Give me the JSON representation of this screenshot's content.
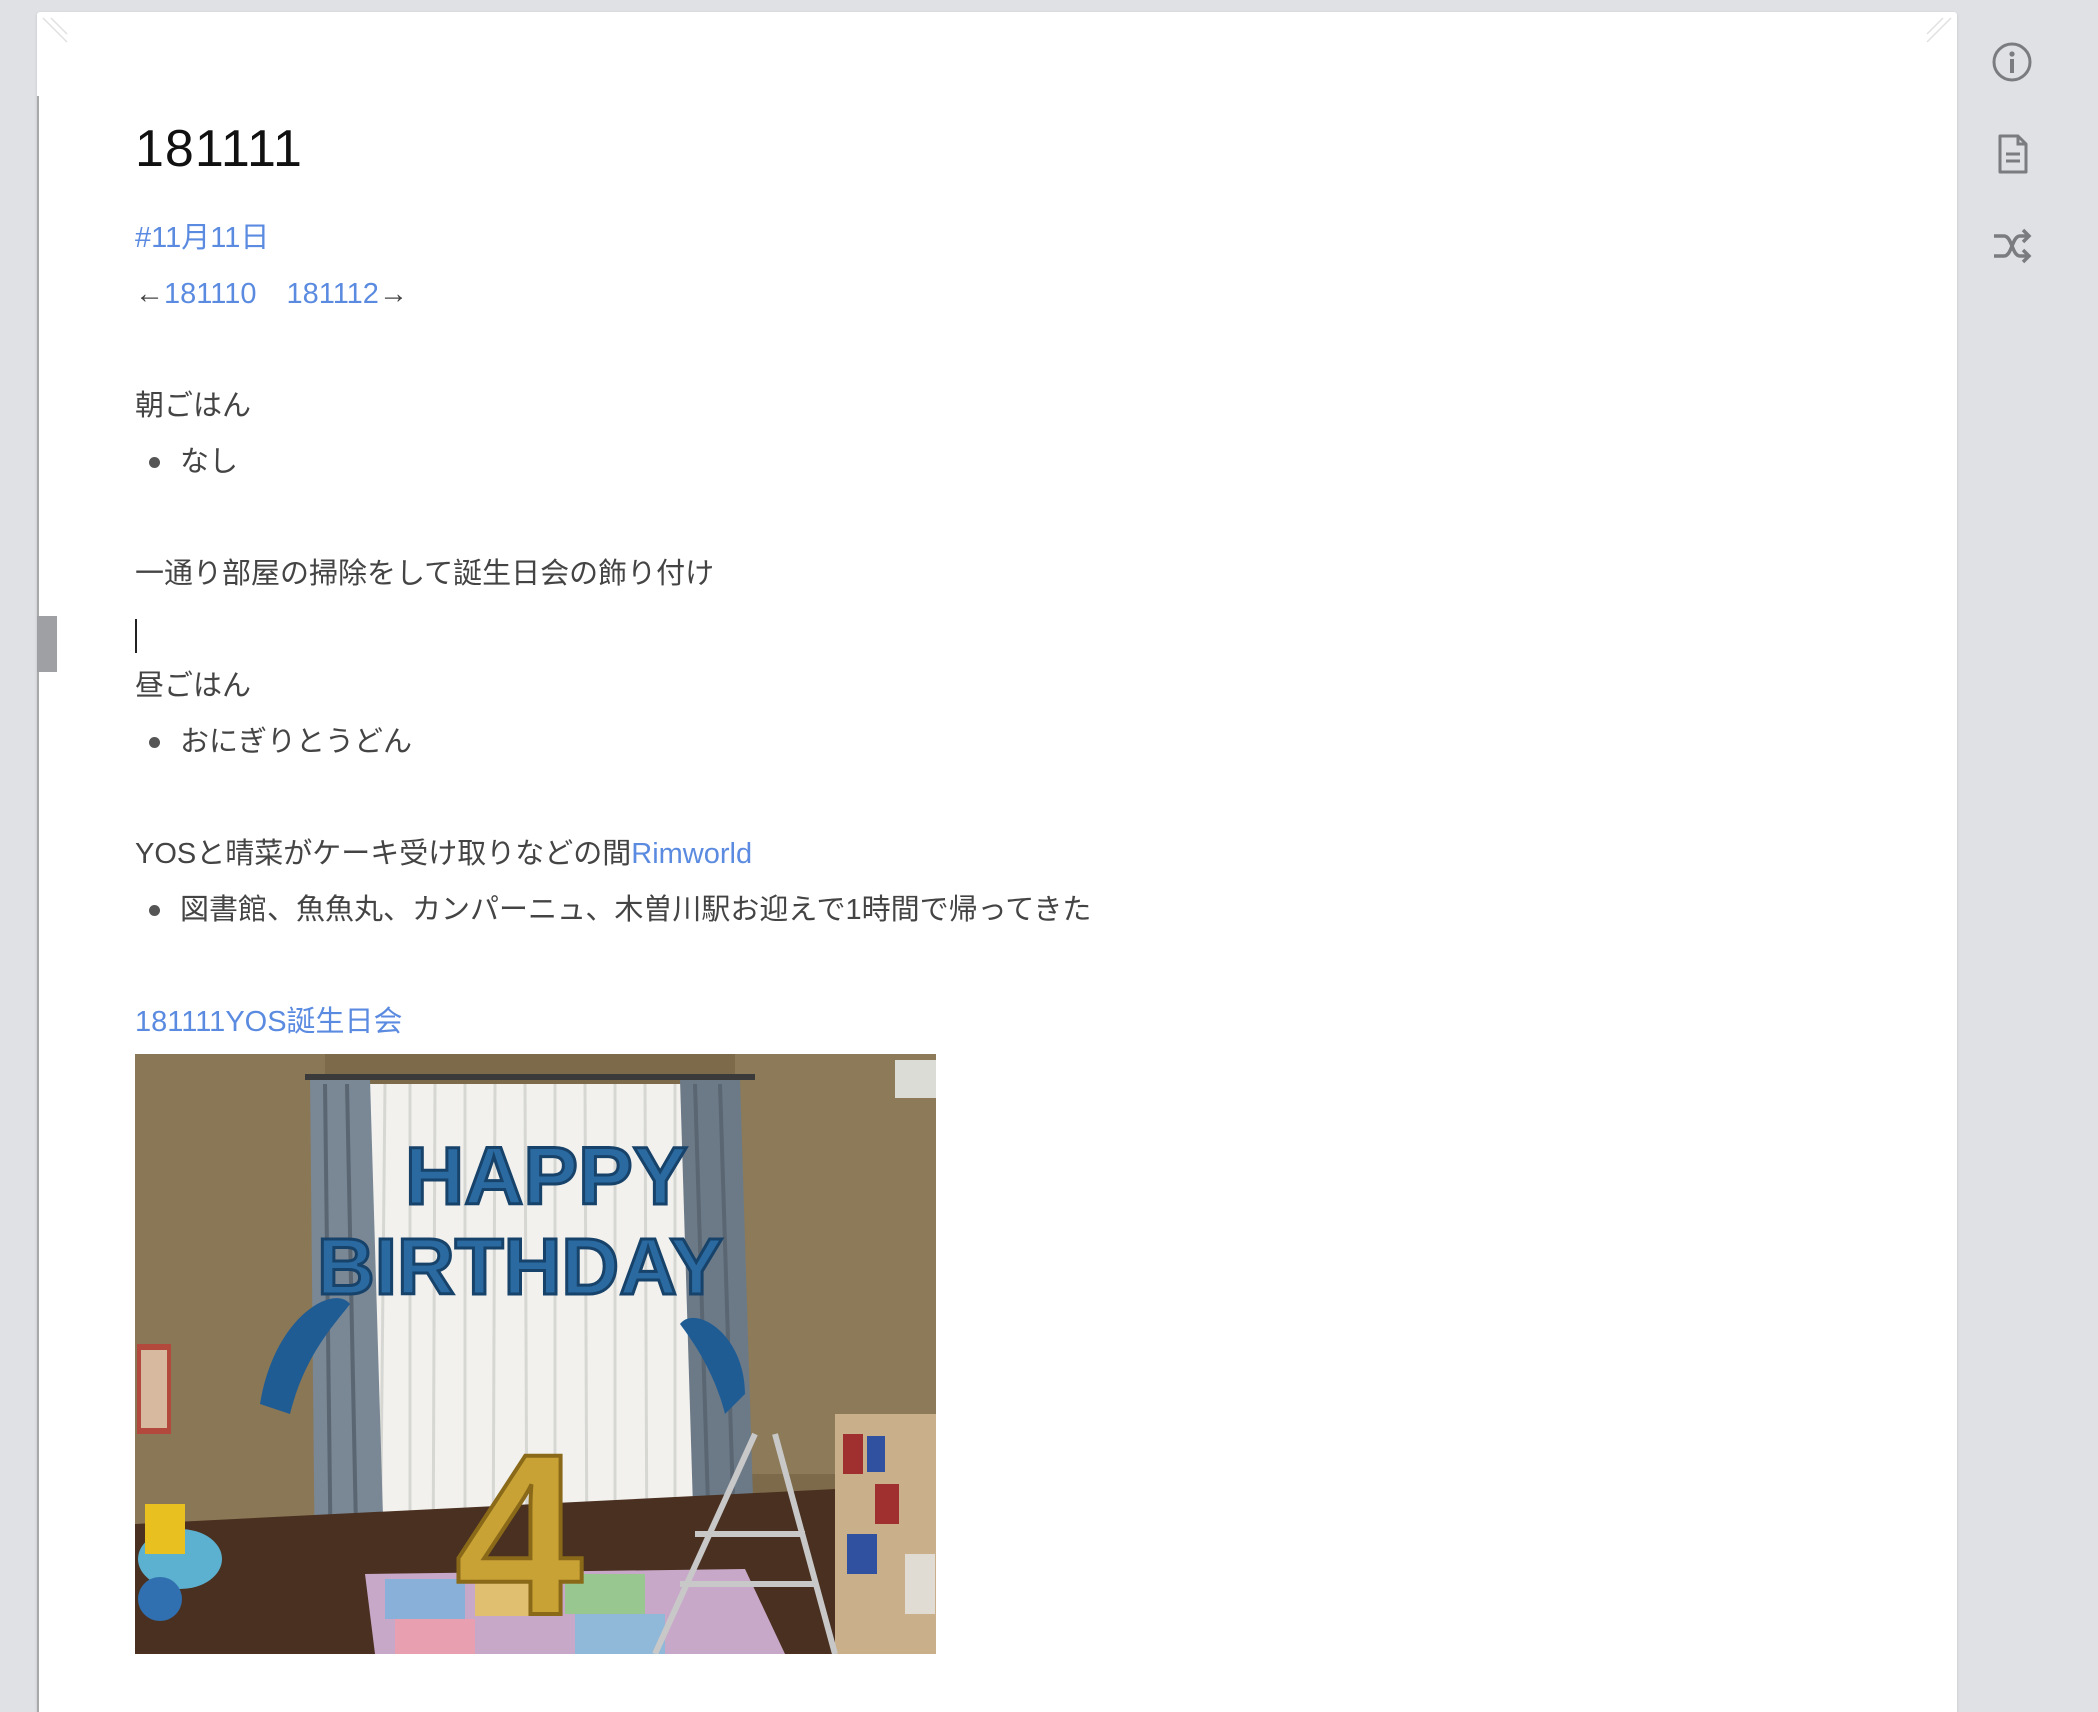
{
  "page": {
    "title": "181111",
    "tag": "#11月11日",
    "nav": {
      "prev_arrow": "←",
      "prev_link": "181110",
      "next_link": "181112",
      "next_arrow": "→"
    },
    "breakfast_heading": "朝ごはん",
    "breakfast_item": "なし",
    "cleaning_text": "一通り部屋の掃除をして誕生日会の飾り付け",
    "lunch_heading": "昼ごはん",
    "lunch_item": "おにぎりとうどん",
    "errand_text": "YOSと晴菜がケーキ受け取りなどの間",
    "errand_link": "Rimworld",
    "errand_item": "図書館、魚魚丸、カンパーニュ、木曽川駅お迎えで1時間で帰ってきた",
    "party_link": "181111YOS誕生日会",
    "photo_texts": {
      "line1": "HAPPY",
      "line2": "BIRTHDAY",
      "number": "4"
    }
  },
  "right_rail": {
    "icons": [
      "info-icon",
      "page-icon",
      "shuffle-icon"
    ]
  },
  "colors": {
    "link": "#5b8be0",
    "background": "#dfe1e5",
    "page": "#ffffff"
  }
}
